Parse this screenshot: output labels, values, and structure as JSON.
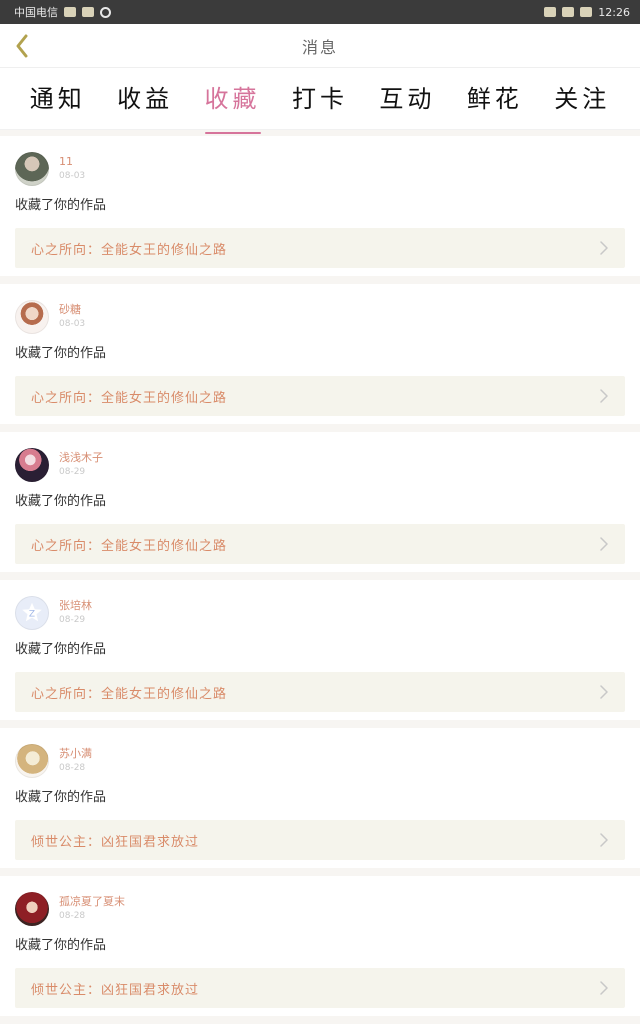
{
  "status_bar": {
    "carrier": "中国电信",
    "time": "12:26"
  },
  "header": {
    "title": "消息"
  },
  "tabs": [
    {
      "label": "通知"
    },
    {
      "label": "收益"
    },
    {
      "label": "收藏"
    },
    {
      "label": "打卡"
    },
    {
      "label": "互动"
    },
    {
      "label": "鲜花"
    },
    {
      "label": "关注"
    }
  ],
  "colors": {
    "accent": "#d6749b",
    "username": "#d78e73",
    "work_title": "#d98b69",
    "card_background": "#f5f4ec"
  },
  "items": [
    {
      "username": "11",
      "date": "08-03",
      "action": "收藏了你的作品",
      "work_title": "心之所向：全能女王的修仙之路",
      "avatar_icon": "user-photo-icon"
    },
    {
      "username": "砂糖",
      "date": "08-03",
      "action": "收藏了你的作品",
      "work_title": "心之所向：全能女王的修仙之路",
      "avatar_icon": "user-photo-icon"
    },
    {
      "username": "浅浅木子",
      "date": "08-29",
      "action": "收藏了你的作品",
      "work_title": "心之所向：全能女王的修仙之路",
      "avatar_icon": "user-photo-icon"
    },
    {
      "username": "张培林",
      "date": "08-29",
      "action": "收藏了你的作品",
      "work_title": "心之所向：全能女王的修仙之路",
      "avatar_icon": "default-avatar-icon"
    },
    {
      "username": "苏小满",
      "date": "08-28",
      "action": "收藏了你的作品",
      "work_title": "倾世公主：凶狂国君求放过",
      "avatar_icon": "user-photo-icon"
    },
    {
      "username": "孤凉夏了夏末",
      "date": "08-28",
      "action": "收藏了你的作品",
      "work_title": "倾世公主：凶狂国君求放过",
      "avatar_icon": "user-photo-icon"
    }
  ]
}
